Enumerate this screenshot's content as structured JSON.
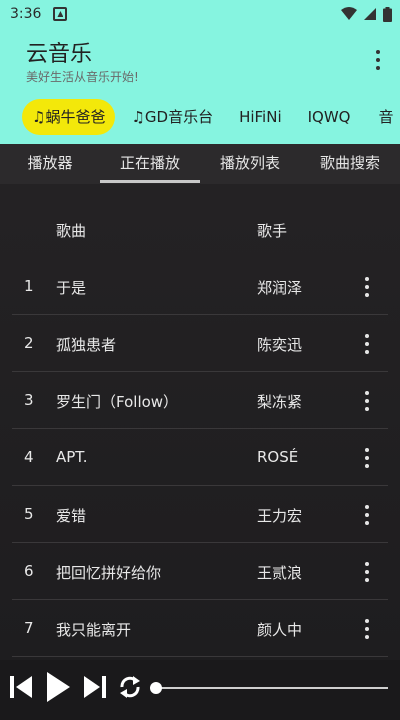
{
  "status_bar": {
    "time": "3:36"
  },
  "header": {
    "title": "云音乐",
    "subtitle": "美好生活从音乐开始!",
    "accent_color": "#86f4e0",
    "active_color": "#f3e80a"
  },
  "source_tabs": [
    {
      "label": "♫蜗牛爸爸",
      "active": true
    },
    {
      "label": "♫GD音乐台",
      "active": false
    },
    {
      "label": "HiFiNi",
      "active": false
    },
    {
      "label": "IQWQ",
      "active": false
    },
    {
      "label": "音",
      "active": false
    }
  ],
  "main_tabs": [
    {
      "label": "播放器",
      "active": false
    },
    {
      "label": "正在播放",
      "active": true
    },
    {
      "label": "播放列表",
      "active": false
    },
    {
      "label": "歌曲搜索",
      "active": false
    }
  ],
  "table": {
    "headers": {
      "song": "歌曲",
      "artist": "歌手"
    },
    "rows": [
      {
        "index": "1",
        "title": "于是",
        "artist": "郑润泽"
      },
      {
        "index": "2",
        "title": "孤独患者",
        "artist": "陈奕迅"
      },
      {
        "index": "3",
        "title": "罗生门（Follow）",
        "artist": "梨冻紧"
      },
      {
        "index": "4",
        "title": "APT.",
        "artist": "ROSÉ"
      },
      {
        "index": "5",
        "title": "爱错",
        "artist": "王力宏"
      },
      {
        "index": "6",
        "title": "把回忆拼好给你",
        "artist": "王贰浪"
      },
      {
        "index": "7",
        "title": "我只能离开",
        "artist": "颜人中"
      }
    ]
  },
  "player": {
    "progress": 0,
    "icons": [
      "skip-previous-icon",
      "play-icon",
      "skip-next-icon",
      "repeat-icon"
    ]
  }
}
